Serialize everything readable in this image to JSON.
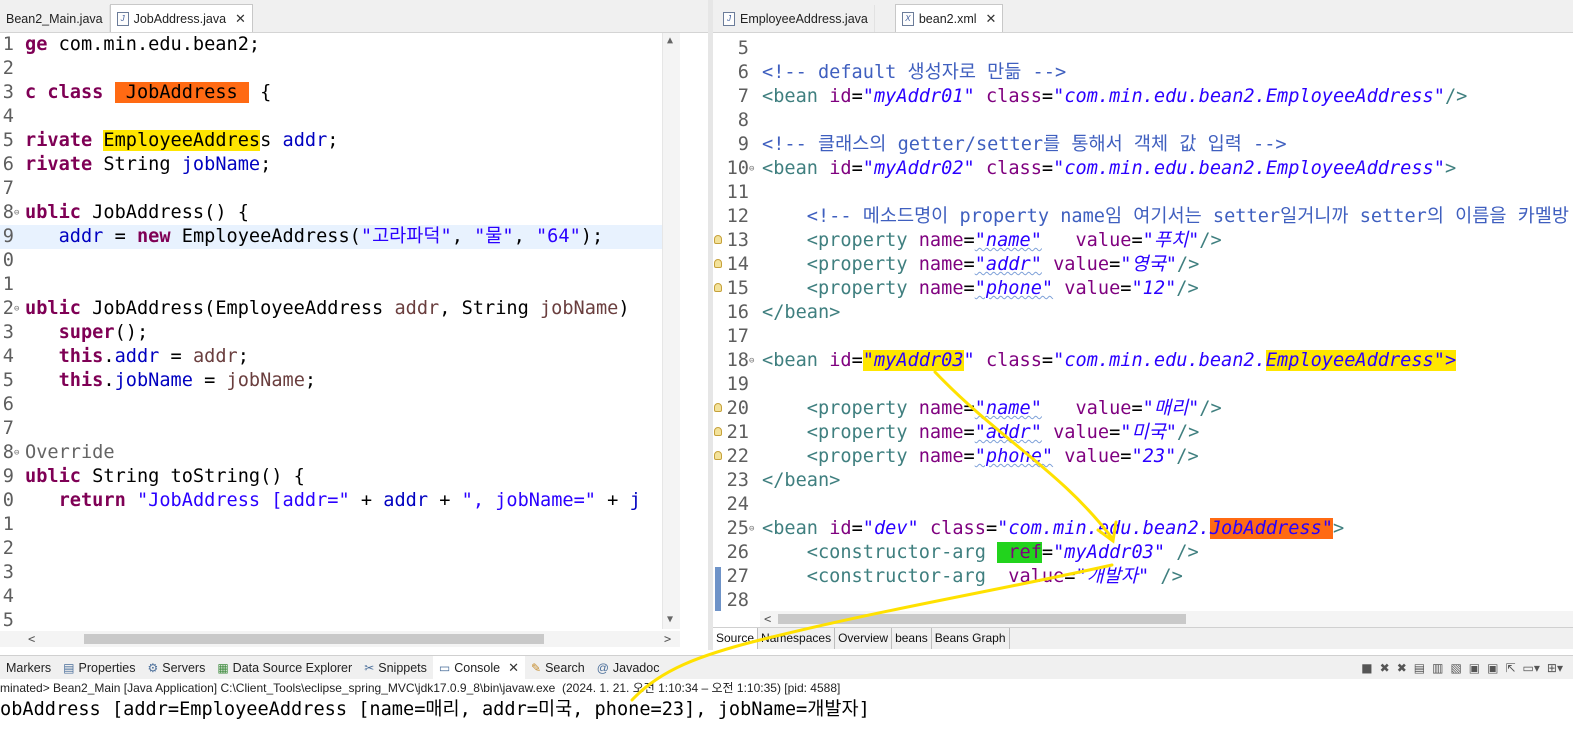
{
  "left_tabs": [
    {
      "label": "Bean2_Main.java",
      "active": false
    },
    {
      "label": "JobAddress.java",
      "active": true
    }
  ],
  "right_tabs": [
    {
      "label": "EmployeeAddress.java",
      "active": false
    },
    {
      "label": "bean2.xml",
      "active": true
    }
  ],
  "java_editor": {
    "lines": [
      {
        "n": "1",
        "t": "ge com.min.edu.bean2;"
      },
      {
        "n": "2",
        "t": ""
      },
      {
        "n": "3",
        "t": "c class JobAddress {"
      },
      {
        "n": "4",
        "t": ""
      },
      {
        "n": "5",
        "t": "rivate EmployeeAddress addr;"
      },
      {
        "n": "6",
        "t": "rivate String jobName;"
      },
      {
        "n": "7",
        "t": ""
      },
      {
        "n": "8",
        "t": "ublic JobAddress() {"
      },
      {
        "n": "9",
        "t": "   addr = new EmployeeAddress(\"고라파덕\", \"물\", \"64\");"
      },
      {
        "n": "0",
        "t": ""
      },
      {
        "n": "1",
        "t": ""
      },
      {
        "n": "2",
        "t": "ublic JobAddress(EmployeeAddress addr, String jobName)"
      },
      {
        "n": "3",
        "t": "   super();"
      },
      {
        "n": "4",
        "t": "   this.addr = addr;"
      },
      {
        "n": "5",
        "t": "   this.jobName = jobName;"
      },
      {
        "n": "6",
        "t": ""
      },
      {
        "n": "7",
        "t": ""
      },
      {
        "n": "8",
        "t": "Override"
      },
      {
        "n": "9",
        "t": "ublic String toString() {"
      },
      {
        "n": "0",
        "t": "   return \"JobAddress [addr=\" + addr + \", jobName=\" + j"
      },
      {
        "n": "1",
        "t": ""
      },
      {
        "n": "2",
        "t": ""
      },
      {
        "n": "3",
        "t": ""
      },
      {
        "n": "4",
        "t": ""
      },
      {
        "n": "5",
        "t": ""
      }
    ]
  },
  "xml_editor": {
    "lines": [
      {
        "n": "5",
        "t": ""
      },
      {
        "n": "6",
        "t": "<!-- default 생성자로 만듦 -->"
      },
      {
        "n": "7",
        "t": "<bean id=\"myAddr01\" class=\"com.min.edu.bean2.EmployeeAddress\"/>"
      },
      {
        "n": "8",
        "t": ""
      },
      {
        "n": "9",
        "t": "<!-- 클래스의 getter/setter를 통해서 객체 값 입력 -->"
      },
      {
        "n": "10",
        "t": "<bean id=\"myAddr02\" class=\"com.min.edu.bean2.EmployeeAddress\">"
      },
      {
        "n": "11",
        "t": ""
      },
      {
        "n": "12",
        "t": "    <!-- 메소드명이 property name임 여기서는 setter일거니까 setter의 이름을 카멜방"
      },
      {
        "n": "13",
        "t": "    <property name=\"name\"   value=\"푸치\"/>"
      },
      {
        "n": "14",
        "t": "    <property name=\"addr\" value=\"영국\"/>"
      },
      {
        "n": "15",
        "t": "    <property name=\"phone\" value=\"12\"/>"
      },
      {
        "n": "16",
        "t": "</bean>"
      },
      {
        "n": "17",
        "t": ""
      },
      {
        "n": "18",
        "t": "<bean id=\"myAddr03\" class=\"com.min.edu.bean2.EmployeeAddress\">"
      },
      {
        "n": "19",
        "t": ""
      },
      {
        "n": "20",
        "t": "    <property name=\"name\"   value=\"매리\"/>"
      },
      {
        "n": "21",
        "t": "    <property name=\"addr\" value=\"미국\"/>"
      },
      {
        "n": "22",
        "t": "    <property name=\"phone\" value=\"23\"/>"
      },
      {
        "n": "23",
        "t": "</bean>"
      },
      {
        "n": "24",
        "t": ""
      },
      {
        "n": "25",
        "t": "<bean id=\"dev\" class=\"com.min.edu.bean2.JobAddress\">"
      },
      {
        "n": "26",
        "t": "    <constructor-arg  ref=\"myAddr03\" />"
      },
      {
        "n": "27",
        "t": "    <constructor-arg  value=\"개발자\" />"
      },
      {
        "n": "28",
        "t": ""
      }
    ]
  },
  "xml_bottom_tabs": [
    "Source",
    "Namespaces",
    "Overview",
    "beans",
    "Beans Graph"
  ],
  "view_tabs": [
    {
      "label": "Markers",
      "icon": "markers-icon"
    },
    {
      "label": "Properties",
      "icon": "properties-icon"
    },
    {
      "label": "Servers",
      "icon": "servers-icon"
    },
    {
      "label": "Data Source Explorer",
      "icon": "data-source-icon"
    },
    {
      "label": "Snippets",
      "icon": "snippets-icon"
    },
    {
      "label": "Console",
      "icon": "console-icon",
      "active": true
    },
    {
      "label": "Search",
      "icon": "search-icon"
    },
    {
      "label": "Javadoc",
      "icon": "javadoc-icon"
    }
  ],
  "console": {
    "status": "minated> Bean2_Main [Java Application] C:\\Client_Tools\\eclipse_spring_MVC\\jdk17.0.9_8\\bin\\javaw.exe  (2024. 1. 21. 오전 1:10:34 – 오전 1:10:35) [pid: 4588]",
    "output": "obAddress [addr=EmployeeAddress [name=매리, addr=미국, phone=23], jobName=개발자]"
  },
  "colors": {
    "highlight_orange": "#ff6a13",
    "highlight_yellow": "#ffe600",
    "highlight_green": "#22d31d",
    "annotation_arrow": "#ffe100"
  }
}
